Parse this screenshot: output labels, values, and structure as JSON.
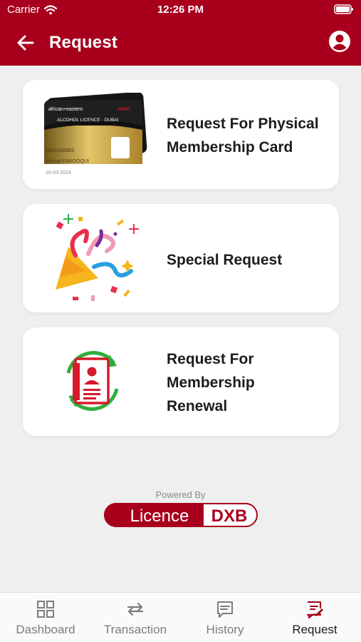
{
  "status_bar": {
    "carrier": "Carrier",
    "time": "12:26 PM"
  },
  "header": {
    "title": "Request"
  },
  "cards": [
    {
      "label_line1": "Request For Physical",
      "label_line2": "Membership Card",
      "icon": "membership-card-image"
    },
    {
      "label_line1": "Special Request",
      "icon": "party-popper-icon"
    },
    {
      "label_line1": "Request For",
      "label_line2": "Membership",
      "label_line3": "Renewal",
      "icon": "renewal-icon"
    }
  ],
  "card_image": {
    "brand_left": "african+eastern",
    "brand_right": "mmi",
    "title": "ALCOHOL LICENCE - DUBAI",
    "number": "2662A0008S",
    "name": "Arshad FAROOQUI",
    "date": "16-03-2024"
  },
  "footer": {
    "powered_by": "Powered By",
    "logo_left": "Licence",
    "logo_right": "DXB"
  },
  "tabs": [
    {
      "label": "Dashboard",
      "icon": "dashboard-icon"
    },
    {
      "label": "Transaction",
      "icon": "transaction-icon"
    },
    {
      "label": "History",
      "icon": "history-icon"
    },
    {
      "label": "Request",
      "icon": "request-icon",
      "active": true
    }
  ],
  "colors": {
    "brand": "#a8001c",
    "background": "#efefef",
    "renewal_green": "#2fae3c"
  }
}
